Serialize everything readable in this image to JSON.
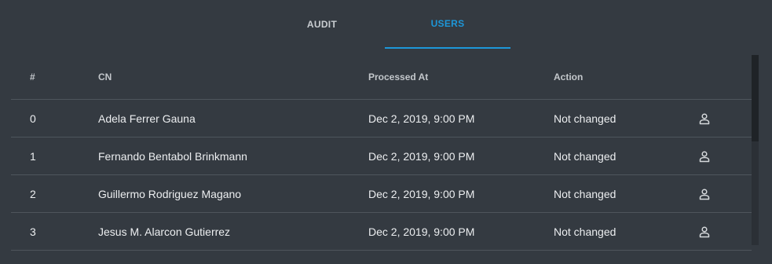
{
  "tabs": [
    {
      "label": "AUDIT",
      "active": false
    },
    {
      "label": "USERS",
      "active": true
    }
  ],
  "colors": {
    "background": "#343a41",
    "accent": "#1d97d9",
    "divider": "#4e555c"
  },
  "table": {
    "headers": {
      "index": "#",
      "cn": "CN",
      "processed_at": "Processed At",
      "action": "Action"
    },
    "rows": [
      {
        "index": "0",
        "cn": "Adela Ferrer Gauna",
        "processed_at": "Dec 2, 2019, 9:00 PM",
        "action": "Not changed",
        "icon": "person-icon"
      },
      {
        "index": "1",
        "cn": "Fernando Bentabol Brinkmann",
        "processed_at": "Dec 2, 2019, 9:00 PM",
        "action": "Not changed",
        "icon": "person-icon"
      },
      {
        "index": "2",
        "cn": "Guillermo Rodriguez Magano",
        "processed_at": "Dec 2, 2019, 9:00 PM",
        "action": "Not changed",
        "icon": "person-icon"
      },
      {
        "index": "3",
        "cn": "Jesus M. Alarcon Gutierrez",
        "processed_at": "Dec 2, 2019, 9:00 PM",
        "action": "Not changed",
        "icon": "person-icon"
      }
    ]
  }
}
